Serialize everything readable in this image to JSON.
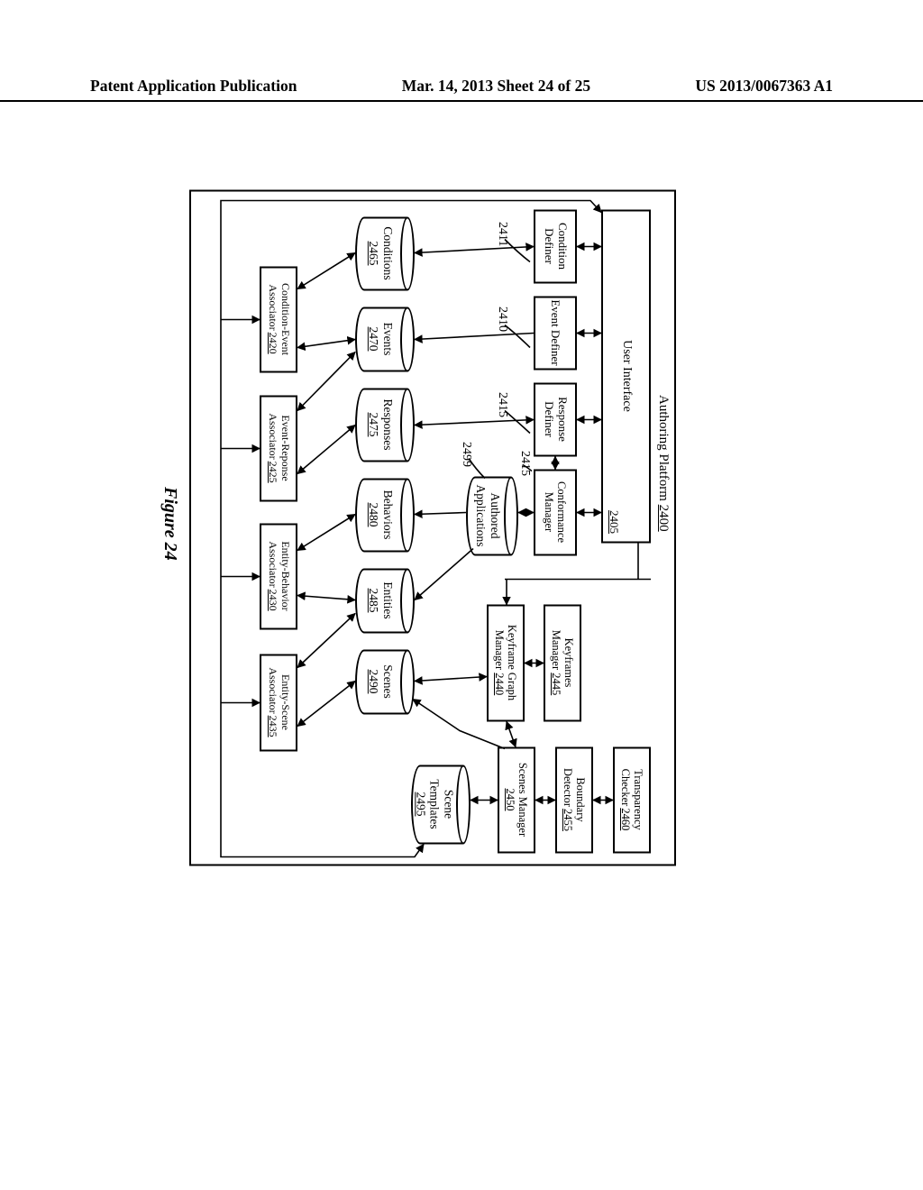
{
  "header": {
    "left": "Patent Application Publication",
    "center": "Mar. 14, 2013  Sheet 24 of 25",
    "right": "US 2013/0067363 A1"
  },
  "diagram": {
    "title": "Authoring Platform",
    "title_num": "2400",
    "figure_label": "Figure 24",
    "boxes": {
      "user_interface": {
        "label": "User Interface",
        "num": "2405"
      },
      "condition_definer": {
        "label": "Condition Definer",
        "num": ""
      },
      "event_definer": {
        "label": "Event Definer",
        "num": ""
      },
      "response_definer": {
        "label": "Response Definer",
        "num": ""
      },
      "conformance_manager": {
        "label": "Conformance Manager",
        "num": ""
      },
      "keyframes_manager": {
        "label": "Keyframes Manager",
        "num": "2445"
      },
      "keyframe_graph_manager": {
        "label": "Keyframe Graph Manager",
        "num": "2440"
      },
      "transparency_checker": {
        "label": "Transparency Checker",
        "num": "2460"
      },
      "boundary_detector": {
        "label": "Boundary Detector",
        "num": "2455"
      },
      "scenes_manager": {
        "label": "Scenes Manager",
        "num": "2450"
      },
      "condition_event_assoc": {
        "label": "Condition-Event Associator",
        "num": "2420"
      },
      "event_response_assoc": {
        "label": "Event-Reponse Associator",
        "num": "2425"
      },
      "entity_behavior_assoc": {
        "label": "Entity-Behavior Associator",
        "num": "2430"
      },
      "entity_scene_assoc": {
        "label": "Entity-Scene Associator",
        "num": "2435"
      }
    },
    "cylinders": {
      "authored_apps": {
        "label": "Authored Applications",
        "num": ""
      },
      "conditions": {
        "label": "Conditions",
        "num": "2465"
      },
      "events": {
        "label": "Events",
        "num": "2470"
      },
      "responses": {
        "label": "Responses",
        "num": "2475"
      },
      "behaviors": {
        "label": "Behaviors",
        "num": "2480"
      },
      "entities": {
        "label": "Entities",
        "num": "2485"
      },
      "scenes": {
        "label": "Scenes",
        "num": "2490"
      },
      "scene_templates": {
        "label": "Scene Templates",
        "num": "2495"
      }
    },
    "leads": {
      "l2411": "2411",
      "l2410": "2410",
      "l2415a": "2415",
      "l2415b": "2415",
      "l2499": "2499"
    }
  }
}
